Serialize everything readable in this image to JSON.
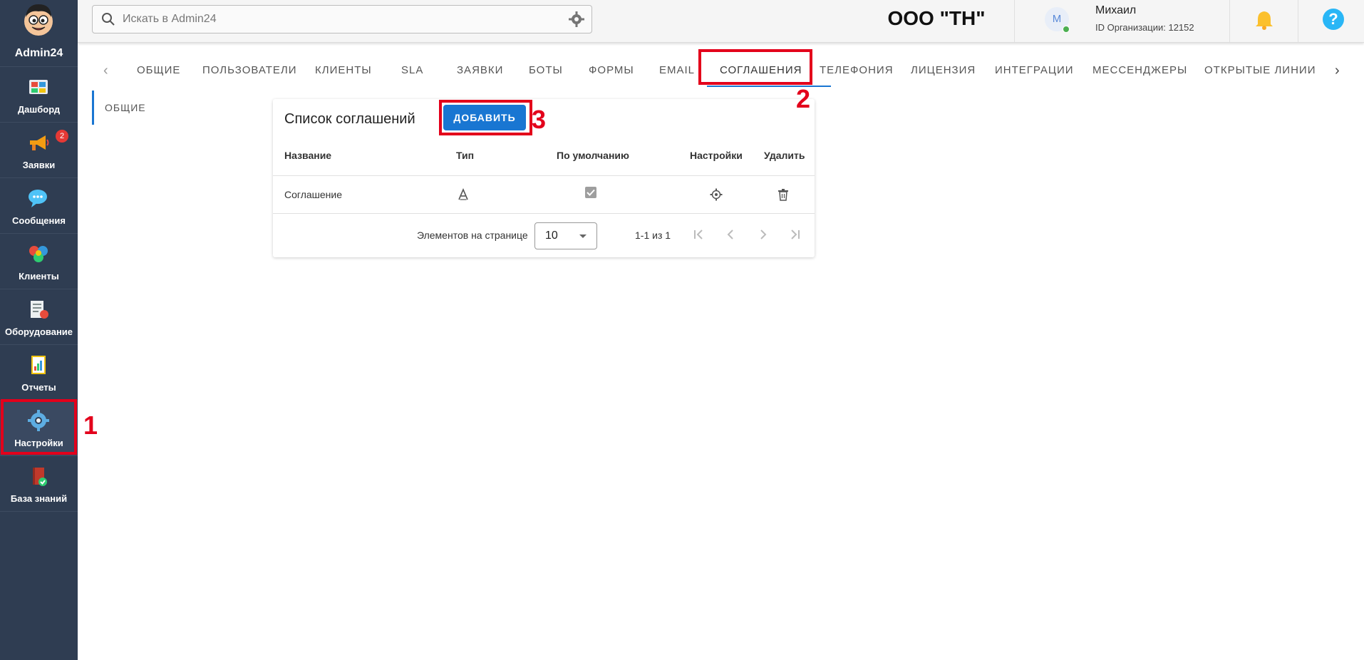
{
  "app": {
    "logo_text": "Admin24",
    "org_title": "ООО \"ТН\""
  },
  "search": {
    "placeholder": "Искать в Admin24"
  },
  "user": {
    "initial": "М",
    "name": "Михаил",
    "org_id": "ID Организации: 12152"
  },
  "sidebar": {
    "items": [
      {
        "label": "Дашборд",
        "icon": "dashboard-icon"
      },
      {
        "label": "Заявки",
        "icon": "megaphone-icon",
        "badge": "2"
      },
      {
        "label": "Сообщения",
        "icon": "chat-icon"
      },
      {
        "label": "Клиенты",
        "icon": "clients-icon"
      },
      {
        "label": "Оборудование",
        "icon": "equipment-icon"
      },
      {
        "label": "Отчеты",
        "icon": "reports-icon"
      },
      {
        "label": "Настройки",
        "icon": "gear-icon"
      },
      {
        "label": "База знаний",
        "icon": "book-icon"
      }
    ]
  },
  "tabs": [
    "ОБЩИЕ",
    "ПОЛЬЗОВАТЕЛИ",
    "КЛИЕНТЫ",
    "SLA",
    "ЗАЯВКИ",
    "БОТЫ",
    "ФОРМЫ",
    "EMAIL",
    "СОГЛАШЕНИЯ",
    "ТЕЛЕФОНИЯ",
    "ЛИЦЕНЗИЯ",
    "ИНТЕГРАЦИИ",
    "МЕССЕНДЖЕРЫ",
    "ОТКРЫТЫЕ ЛИНИИ"
  ],
  "active_tab": "СОГЛАШЕНИЯ",
  "subnav": {
    "label": "ОБЩИЕ"
  },
  "card": {
    "title": "Список соглашений",
    "add_label": "ДОБАВИТЬ",
    "columns": [
      "Название",
      "Тип",
      "По умолчанию",
      "Настройки",
      "Удалить"
    ],
    "rows": [
      {
        "name": "Соглашение",
        "type_icon": "text-type-icon",
        "default": true
      }
    ],
    "pager": {
      "label": "Элементов на странице",
      "per_page": "10",
      "range": "1-1 из 1"
    }
  },
  "annotations": [
    "1",
    "2",
    "3"
  ],
  "colors": {
    "sidebar": "#2f3d52",
    "accent": "#1976d2",
    "highlight": "#e3001b"
  }
}
